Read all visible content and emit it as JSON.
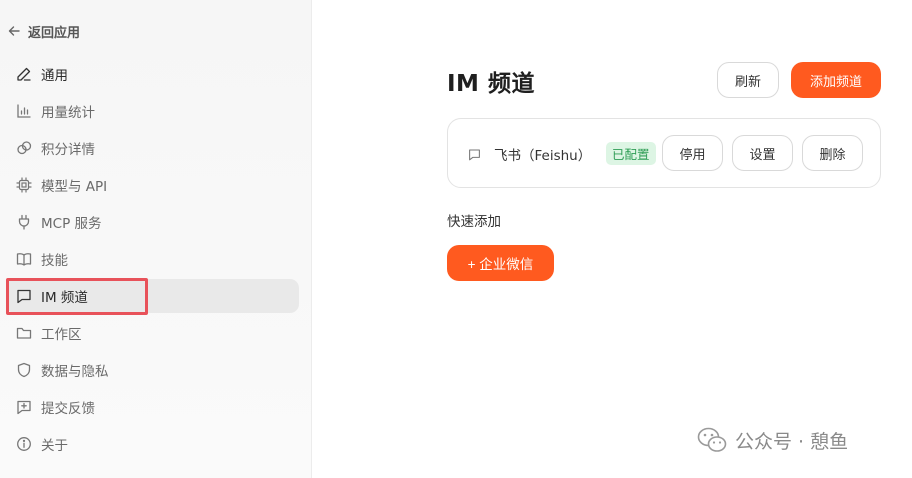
{
  "sidebar": {
    "back_label": "返回应用",
    "items": [
      {
        "label": "通用",
        "icon": "pen-icon"
      },
      {
        "label": "用量统计",
        "icon": "bar-chart-icon"
      },
      {
        "label": "积分详情",
        "icon": "coins-icon"
      },
      {
        "label": "模型与 API",
        "icon": "chip-icon"
      },
      {
        "label": "MCP 服务",
        "icon": "plug-icon"
      },
      {
        "label": "技能",
        "icon": "book-icon"
      },
      {
        "label": "IM 频道",
        "icon": "message-icon"
      },
      {
        "label": "工作区",
        "icon": "folder-icon"
      },
      {
        "label": "数据与隐私",
        "icon": "shield-icon"
      },
      {
        "label": "提交反馈",
        "icon": "feedback-icon"
      },
      {
        "label": "关于",
        "icon": "info-icon"
      }
    ],
    "active_index": 6
  },
  "main": {
    "title": "IM 频道",
    "refresh_label": "刷新",
    "add_channel_label": "添加频道",
    "channels": [
      {
        "name": "飞书（Feishu）",
        "status": "已配置",
        "disable_label": "停用",
        "settings_label": "设置",
        "delete_label": "删除"
      }
    ],
    "quick_add_title": "快速添加",
    "quick_add_button": "+ 企业微信"
  },
  "watermark": {
    "text": "公众号 · 憩鱼"
  },
  "colors": {
    "accent": "#ff5a1f",
    "status_bg": "#ddf5e4",
    "status_text": "#2e9d55",
    "highlight": "#e8525a",
    "active_bg": "#e9e9e9"
  }
}
